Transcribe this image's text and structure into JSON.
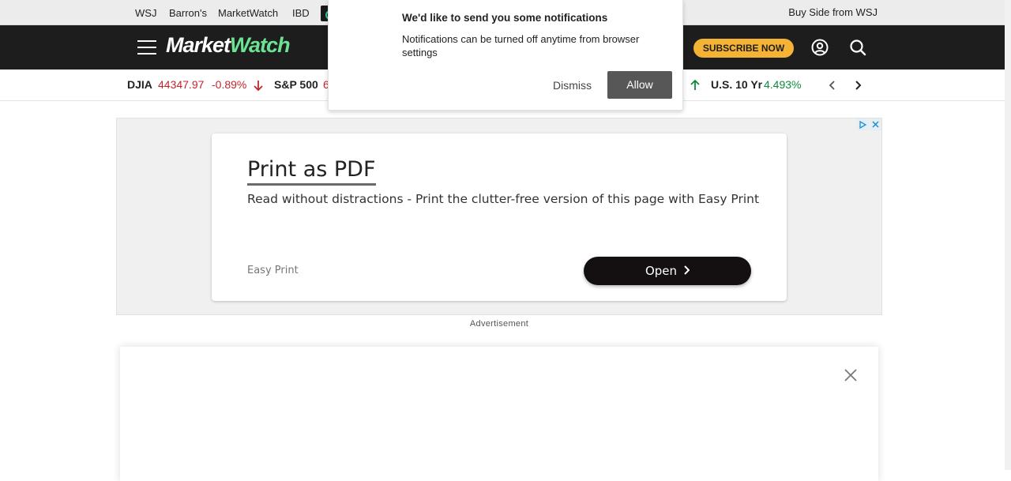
{
  "brand_strip": {
    "links": [
      "WSJ",
      "Barron's",
      "MarketWatch",
      "IBD"
    ],
    "buy_side": "Buy Side from WSJ"
  },
  "header": {
    "logo_part1": "Market",
    "logo_part2": "Watch",
    "subscribe_label": "SUBSCRIBE NOW"
  },
  "ticker": {
    "items": [
      {
        "name": "DJIA",
        "value": "44347.97",
        "change": "-0.89%",
        "direction": "down"
      },
      {
        "name": "S&P 500",
        "value": "6",
        "change": "",
        "direction": "down"
      },
      {
        "name": "U.S. 10 Yr",
        "value": "4.493%",
        "change": "",
        "direction": "up"
      }
    ]
  },
  "notification": {
    "title": "We'd like to send you some notifications",
    "body": "Notifications can be turned off anytime from browser settings",
    "dismiss_label": "Dismiss",
    "allow_label": "Allow"
  },
  "ad": {
    "headline": "Print as PDF",
    "description": "Read without distractions - Print the clutter-free version of this page with Easy Print",
    "brand": "Easy Print",
    "cta_label": "Open",
    "label": "Advertisement"
  },
  "colors": {
    "header_bg": "#1d1d1d",
    "logo_accent": "#6ce392",
    "subscribe_bg": "#f5b335",
    "negative": "#c0262d",
    "positive": "#0f8a3e",
    "allow_bg": "#575757"
  }
}
